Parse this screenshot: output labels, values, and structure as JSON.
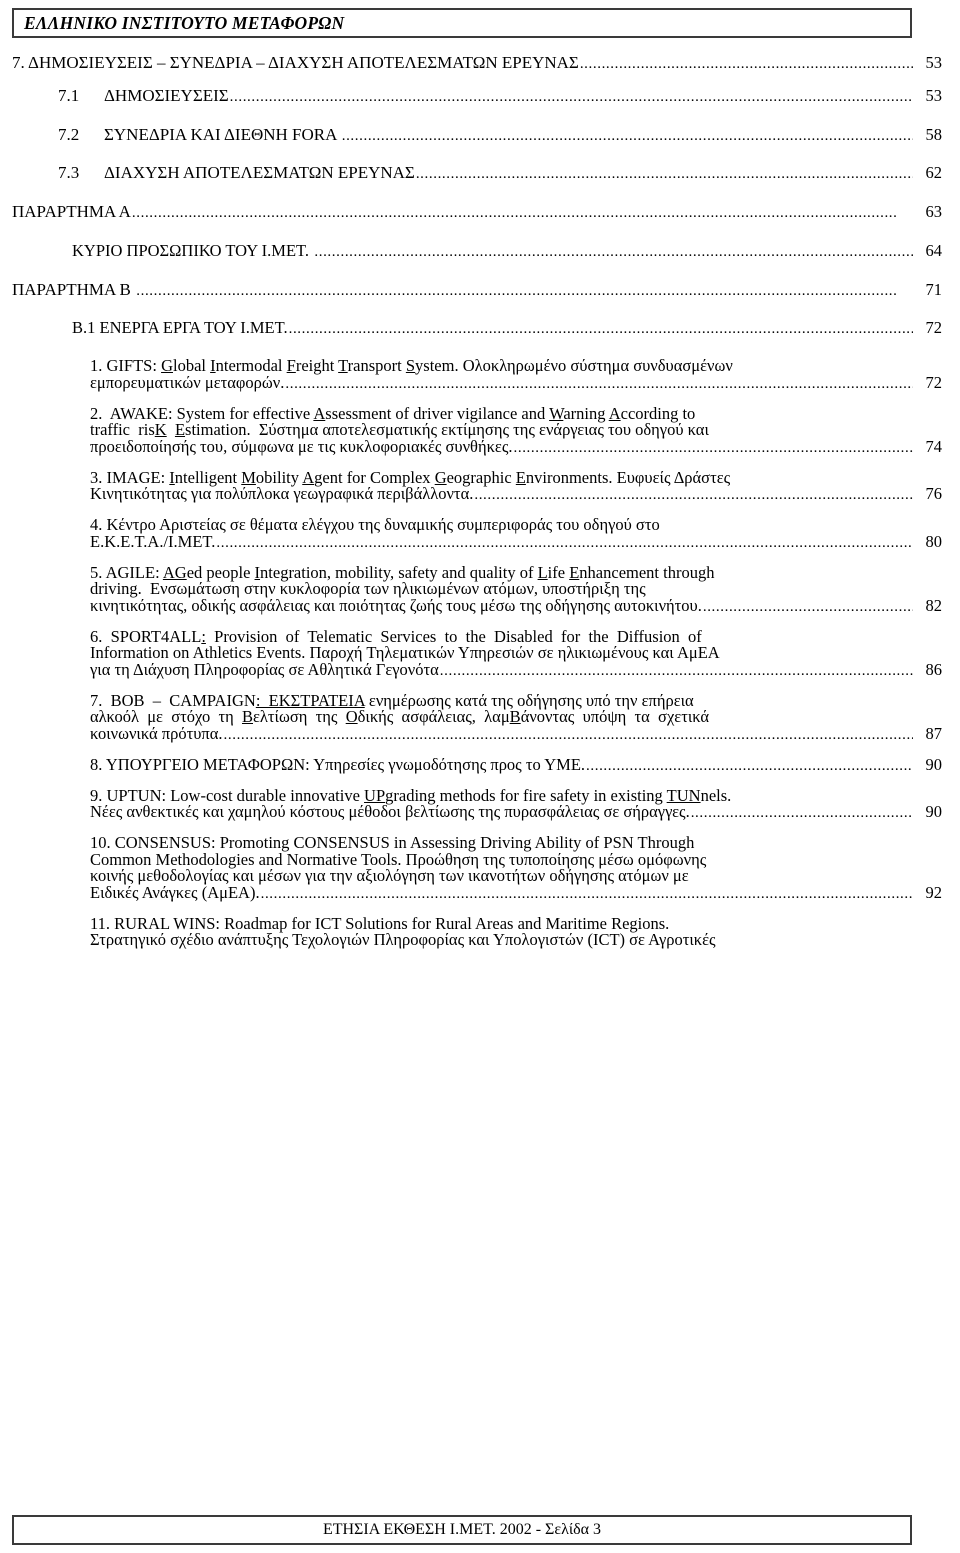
{
  "header": {
    "title": "ΕΛΛΗΝΙΚΟ ΙΝΣΤΙΤΟΥΤΟ ΜΕΤΑΦΟΡΩΝ"
  },
  "footer": {
    "title": "ΕΤΗΣΙΑ ΕΚΘΕΣΗ Ι.ΜΕΤ. 2002 - Σελίδα 3"
  },
  "toc": {
    "entries": [
      {
        "id": "section-7",
        "level": 1,
        "label": "7. ΔΗΜΟΣΙΕΥΣΕΙΣ – ΣΥΝΕΔΡΙΑ – ΔΙΑΧΥΣΗ ΑΠΟΤΕΛΕΣΜΑΤΩΝ ΕΡΕΥΝΑΣ",
        "page": "53"
      },
      {
        "id": "section-7-1",
        "level": 2,
        "number": "7.1",
        "label": "ΔΗΜΟΣΙΕΥΣΕΙΣ",
        "page": "53"
      },
      {
        "id": "section-7-2",
        "level": 2,
        "number": "7.2",
        "label": "ΣΥΝΕΔΡΙΑ ΚΑΙ ΔΙΕΘΝΗ FORA",
        "page": "58"
      },
      {
        "id": "section-7-3",
        "level": 2,
        "number": "7.3",
        "label": "ΔΙΑΧΥΣΗ ΑΠΟΤΕΛΕΣΜΑΤΩΝ ΕΡΕΥΝΑΣ",
        "page": "62"
      },
      {
        "id": "annex-a",
        "level": 1,
        "label": "ΠΑΡΑΡΤΗΜΑ Α",
        "page": "63"
      },
      {
        "id": "annex-a-staff",
        "level": 3,
        "label": "ΚΥΡΙΟ ΠΡΟΣΩΠΙΚΟ ΤΟΥ Ι.ΜΕΤ.",
        "page": "64"
      },
      {
        "id": "annex-b",
        "level": 1,
        "label": "ΠΑΡΑΡΤΗΜΑ Β",
        "page": "71"
      },
      {
        "id": "annex-b-1",
        "level": 3,
        "label": "Β.1 ΕΝΕΡΓΑ ΕΡΓΑ ΤΟΥ Ι.ΜΕΤ.",
        "page": "72"
      }
    ],
    "projects": [
      {
        "id": "project-1-gifts",
        "number": "1.",
        "acronym": "GIFTS:",
        "title_parts": [
          {
            "t": " ",
            "u": false
          },
          {
            "t": "G",
            "u": true
          },
          {
            "t": "lobal ",
            "u": false
          },
          {
            "t": "I",
            "u": true
          },
          {
            "t": "ntermodal ",
            "u": false
          },
          {
            "t": "F",
            "u": true
          },
          {
            "t": "reight ",
            "u": false
          },
          {
            "t": "T",
            "u": true
          },
          {
            "t": "ransport ",
            "u": false
          },
          {
            "t": "S",
            "u": true
          },
          {
            "t": "ystem.",
            "u": false
          }
        ],
        "plain_title": "GIFTS: Global Intermodal Freight Transport System.",
        "description_first": "Ολοκληρωμένο σύστημα συνδυασμένων",
        "description_last": "εμπορευματικών μεταφορών.",
        "page": "72"
      },
      {
        "id": "project-2-awake",
        "number": "2.",
        "acronym": "AWAKE:",
        "title_parts": [
          {
            "t": " System for effective ",
            "u": false
          },
          {
            "t": "A",
            "u": true
          },
          {
            "t": "ssessment of driver vigilance and ",
            "u": false
          },
          {
            "t": "W",
            "u": true
          },
          {
            "t": "arning ",
            "u": false
          },
          {
            "t": "A",
            "u": true
          },
          {
            "t": "ccording to",
            "u": false
          }
        ],
        "title_line2_parts": [
          {
            "t": "traffic  ris",
            "u": false
          },
          {
            "t": "K",
            "u": true
          },
          {
            "t": "  ",
            "u": false
          },
          {
            "t": "E",
            "u": true
          },
          {
            "t": "stimation.",
            "u": false
          }
        ],
        "plain_title": "AWAKE: System for effective Assessment of driver vigilance and Warning According to traffic risK Estimation.",
        "description_first": "Σύστημα αποτελεσματικής εκτίμησης της ενάργειας του οδηγού και",
        "description_last": "προειδοποίησής του, σύμφωνα με τις κυκλοφοριακές συνθήκες.",
        "page": "74"
      },
      {
        "id": "project-3-image",
        "number": "3.",
        "acronym": "IMAGE:",
        "title_parts": [
          {
            "t": " ",
            "u": false
          },
          {
            "t": "I",
            "u": true
          },
          {
            "t": "ntelligent ",
            "u": false
          },
          {
            "t": "M",
            "u": true
          },
          {
            "t": "obility ",
            "u": false
          },
          {
            "t": "A",
            "u": true
          },
          {
            "t": "gent for Complex ",
            "u": false
          },
          {
            "t": "G",
            "u": true
          },
          {
            "t": "eographic ",
            "u": false
          },
          {
            "t": "E",
            "u": true
          },
          {
            "t": "nvironments.",
            "u": false
          }
        ],
        "plain_title": "IMAGE: Intelligent Mobility Agent for Complex Geographic Environments.",
        "description_first": "Ευφυείς Δράστες",
        "description_last": "Κινητικότητας για πολύπλοκα γεωγραφικά περιβάλλοντα.",
        "page": "76"
      },
      {
        "id": "project-4-kentro-aristeias",
        "number": "4.",
        "acronym": "",
        "plain_title": "Κέντρο Αριστείας σε θέματα ελέγχου της δυναμικής συμπεριφοράς του οδηγού στο Ε.Κ.Ε.Τ.Α./Ι.ΜΕΤ.",
        "description_first": "Κέντρο  Αριστείας  σε  θέματα  ελέγχου  της  δυναμικής  συμπεριφοράς  του  οδηγού  στο",
        "description_last": "Ε.Κ.Ε.Τ.Α./Ι.ΜΕΤ.",
        "page": "80"
      },
      {
        "id": "project-5-agile",
        "number": "5.",
        "acronym": "AGILE:",
        "title_parts": [
          {
            "t": " ",
            "u": false
          },
          {
            "t": "AG",
            "u": true
          },
          {
            "t": "ed people ",
            "u": false
          },
          {
            "t": "I",
            "u": true
          },
          {
            "t": "ntegration, mobility, safety and quality of ",
            "u": false
          },
          {
            "t": "L",
            "u": true
          },
          {
            "t": "ife ",
            "u": false
          },
          {
            "t": "E",
            "u": true
          },
          {
            "t": "nhancement through",
            "u": false
          }
        ],
        "title_line2_parts": [
          {
            "t": "driving.",
            "u": false
          }
        ],
        "plain_title": "AGILE: AGed people Integration, mobility, safety and quality of Life Enhancement through driving.",
        "description_first": "Ενσωμάτωση  στην  κυκλοφορία  των  ηλικιωμένων  ατόμων,  υποστήριξη  της",
        "description_last": "κινητικότητας, οδικής ασφάλειας και ποιότητας ζωής τους μέσω της οδήγησης αυτοκινήτου.",
        "page": "82"
      },
      {
        "id": "project-6-sport4all",
        "number": "6.",
        "acronym": "SPORT4ALL:",
        "title_parts": [
          {
            "t": "  Provision  of  Telematic  Services  to  the  Disabled  for  the  Diffusion  of",
            "u": false
          }
        ],
        "title_line2_parts": [
          {
            "t": "Information on Athletics Events.",
            "u": false
          }
        ],
        "plain_title": "SPORT4ALL: Provision of Telematic Services to the Disabled for the Diffusion of Information on Athletics Events.",
        "description_first": "Παροχή Τηλεματικών Υπηρεσιών σε ηλικιωμένους και ΑμΕΑ",
        "description_last": "για τη Διάχυση Πληροφορίας σε Αθλητικά Γεγονότα",
        "page": "86"
      },
      {
        "id": "project-7-bob-campaign",
        "number": "7.",
        "acronym": "BOB – CAMPAIGN:",
        "plain_title": "BOB – CAMPAIGN: ΕΚΣΤΡΑΤΕΙΑ ενημέρωσης κατά της οδήγησης υπό την επήρεια αλκοόλ με στόχο τη Βελτίωση της Οδικής ασφάλειας, λαμΒάνοντας υπόψη τα σχετικά κοινωνικά πρότυπα.",
        "page": "87"
      },
      {
        "id": "project-8-ypourgeio",
        "number": "8.",
        "acronym": "ΥΠΟΥΡΓΕΙΟ ΜΕΤΑΦΟΡΩΝ:",
        "plain_title": "ΥΠΟΥΡΓΕΙΟ ΜΕΤΑΦΟΡΩΝ: Υπηρεσίες γνωμοδότησης προς το ΥΜΕ.",
        "description_last": "ΥΠΟΥΡΓΕΙΟ ΜΕΤΑΦΟΡΩΝ: Υπηρεσίες γνωμοδότησης προς το ΥΜΕ.",
        "page": "90"
      },
      {
        "id": "project-9-uptun",
        "number": "9.",
        "acronym": "UPTUN:",
        "plain_title": "UPTUN: Low-cost durable innovative UPgrading methods for fire safety in existing TUNnels.",
        "description_last": "Νέες ανθεκτικές και χαμηλού κόστους μέθοδοι βελτίωσης της πυρασφάλειας σε σήραγγες.",
        "page": "90"
      },
      {
        "id": "project-10-consensus",
        "number": "10.",
        "acronym": "CONSENSUS:",
        "plain_title": "CONSENSUS: Promoting CONSENSUS in Assessing Driving Ability of PSN Through Common Methodologies and Normative Tools.",
        "description_last": "Ειδικές Ανάγκες (ΑμΕΑ).",
        "page": "92"
      },
      {
        "id": "project-11-rural-wins",
        "number": "11.",
        "acronym": "RURAL WINS:",
        "plain_title": "RURAL WINS: Roadmap for ICT Solutions for Rural Areas and Maritime Regions.",
        "description_last": "Στρατηγικό σχέδιο ανάπτυξης Τεχολογιών Πληροφορίας και Υπολογιστών (ICT) σε Αγροτικές",
        "page": ""
      }
    ],
    "project_lines": {
      "p1_l1": "1. GIFTS: Global Intermodal Freight Transport System. Ολοκληρωμένο σύστημα συνδυασμένων",
      "p1_l2": "εμπορευματικών μεταφορών.",
      "p1_page": "72",
      "p2_l1": "2.  AWAKE: System for effective Assessment of driver vigilance and Warning According to",
      "p2_l2": "traffic  risK  Estimation.  Σύστημα  αποτελεσματικής  εκτίμησης  της  ενάργειας  του  οδηγού  και",
      "p2_l3": "προειδοποίησής του, σύμφωνα με τις κυκλοφοριακές συνθήκες.",
      "p2_page": "74",
      "p3_l1": "3. IMAGE: Intelligent Mobility Agent for Complex Geographic Environments. Ευφυείς Δράστες",
      "p3_l2": "Κινητικότητας για πολύπλοκα γεωγραφικά περιβάλλοντα.",
      "p3_page": "76",
      "p4_l1": "4.  Κέντρο  Αριστείας  σε  θέματα  ελέγχου  της  δυναμικής  συμπεριφοράς  του  οδηγού  στο",
      "p4_l2": "Ε.Κ.Ε.Τ.Α./Ι.ΜΕΤ.",
      "p4_page": "80",
      "p5_l1": "5. AGILE: AGed people Integration, mobility, safety and quality of Life Enhancement through",
      "p5_l2": "driving.  Ενσωμάτωση  στην  κυκλοφορία  των  ηλικιωμένων  ατόμων,  υποστήριξη  της",
      "p5_l3": "κινητικότητας, οδικής ασφάλειας και ποιότητας ζωής τους μέσω της οδήγησης αυτοκινήτου.",
      "p5_page": "82",
      "p6_l1": "6.  SPORT4ALL:  Provision  of  Telematic  Services  to  the  Disabled  for  the  Diffusion  of",
      "p6_l2": "Information on Athletics Events. Παροχή Τηλεματικών Υπηρεσιών σε ηλικιωμένους και ΑμΕΑ",
      "p6_l3": "για τη Διάχυση Πληροφορίας σε Αθλητικά Γεγονότα",
      "p6_page": "86",
      "p7_l1": "7.  BOB  –  CAMPAIGN: ΕΚΣΤΡΑΤΕΙΑ ενημέρωσης κατά της οδήγησης υπό την επήρεια",
      "p7_l2": "αλκοόλ  με  στόχο  τη  Βελτίωση  της  Οδικής  ασφάλειας,  λαμΒάνοντας  υπόψη  τα  σχετικά",
      "p7_l3": "κοινωνικά πρότυπα.",
      "p7_page": "87",
      "p8_l1": "8. ΥΠΟΥΡΓΕΙΟ ΜΕΤΑΦΟΡΩΝ: Υπηρεσίες γνωμοδότησης προς το ΥΜΕ.",
      "p8_page": "90",
      "p9_l1": "9. UPTUN: Low-cost durable innovative UPgrading methods for fire safety in existing TUNnels.",
      "p9_l2": "Νέες ανθεκτικές και χαμηλού κόστους μέθοδοι βελτίωσης της πυρασφάλειας σε σήραγγες.",
      "p9_page": "90",
      "p10_l1": "10. CONSENSUS: Promoting CONSENSUS in Assessing Driving Ability of PSN Through",
      "p10_l2": "Common Methodologies and Normative Tools. Προώθηση της τυποποίησης μέσω  ομόφωνης",
      "p10_l3": "κοινής  μεθοδολογίας  και  μέσων  για  την  αξιολόγηση  των  ικανοτήτων  οδήγησης  ατόμων  με",
      "p10_l4": "Ειδικές Ανάγκες (ΑμΕΑ).",
      "p10_page": "92",
      "p11_l1": "11.  RURAL  WINS:  Roadmap  for  ICT  Solutions  for  Rural  Areas  and  Maritime  Regions.",
      "p11_l2": "Στρατηγικό σχέδιο ανάπτυξης Τεχολογιών Πληροφορίας και Υπολογιστών (ICT) σε Αγροτικές"
    }
  }
}
